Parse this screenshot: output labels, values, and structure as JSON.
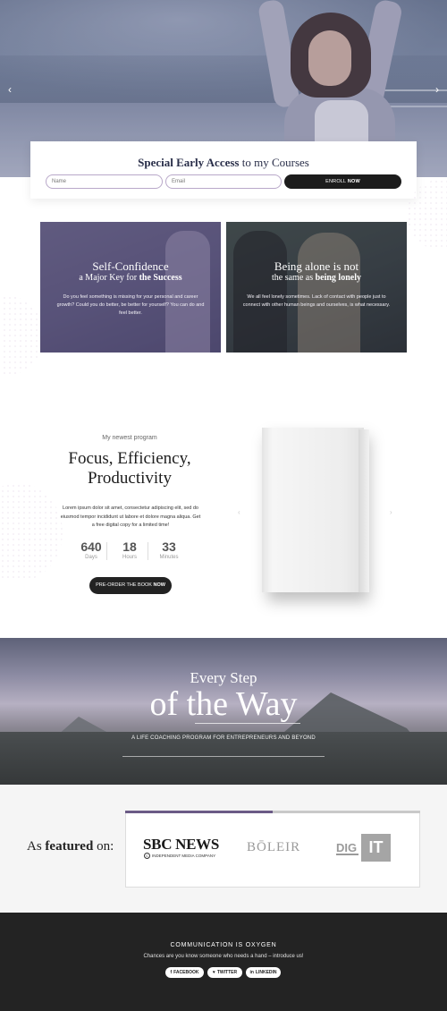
{
  "hero": {
    "prev_arrow": "‹",
    "next_arrow": "›"
  },
  "enroll": {
    "title_bold": "Special Early Access",
    "title_rest": " to my Courses",
    "name_placeholder": "Name",
    "email_placeholder": "Email",
    "button_prefix": "ENROLL ",
    "button_bold": "NOW"
  },
  "cards": [
    {
      "heading1": "Self-Confidence",
      "heading2_prefix": "a Major Key for ",
      "heading2_bold": "the Success",
      "text": "Do you feel something is missing for your personal and career growth? Could you do better, be better for yourself? You can do and feel better."
    },
    {
      "heading1": "Being alone is not",
      "heading2_prefix": "the same as ",
      "heading2_bold": "being lonely",
      "text": "We all feel lonely sometimes. Lack of contact with people just to connect with other human beings and ourselves, is what necessary."
    }
  ],
  "program": {
    "kicker": "My newest program",
    "title_line1": "Focus, Efficiency,",
    "title_line2": "Productivity",
    "description": "Lorem ipsum dolor sit amet, consectetur adipiscing elit, sed do eiusmod tempor incididunt ut labore et dolore magna aliqua. Get a free digital copy for a limited time!",
    "countdown": [
      {
        "value": "640",
        "label": "Days"
      },
      {
        "value": "18",
        "label": "Hours"
      },
      {
        "value": "33",
        "label": "Minutes"
      }
    ],
    "button_prefix": "PRE-ORDER THE BOOK ",
    "button_bold": "NOW",
    "book_prev": "‹",
    "book_next": "›"
  },
  "banner": {
    "line1": "Every Step",
    "line2": "of the Way",
    "subtitle": "A LIFE COACHING PROGRAM FOR ENTREPRENEURS AND BEYOND"
  },
  "featured": {
    "label_prefix": "As ",
    "label_bold": "featured",
    "label_suffix": " on:",
    "sbc_title": "SBC NEWS",
    "sbc_mark": "c",
    "sbc_sub": "INDEPENDENT MEDIA COMPANY",
    "boleir": "BŌLEIR",
    "dig": "DIG",
    "it": "IT"
  },
  "footer": {
    "title": "COMMUNICATION IS OXYGEN",
    "subtitle": "Chances are you know someone who needs a hand – introduce us!",
    "social": [
      {
        "icon": "f",
        "label": "FACEBOOK"
      },
      {
        "icon": "♥",
        "label": "TWITTER"
      },
      {
        "icon": "in",
        "label": "LINKEDIN"
      }
    ]
  }
}
